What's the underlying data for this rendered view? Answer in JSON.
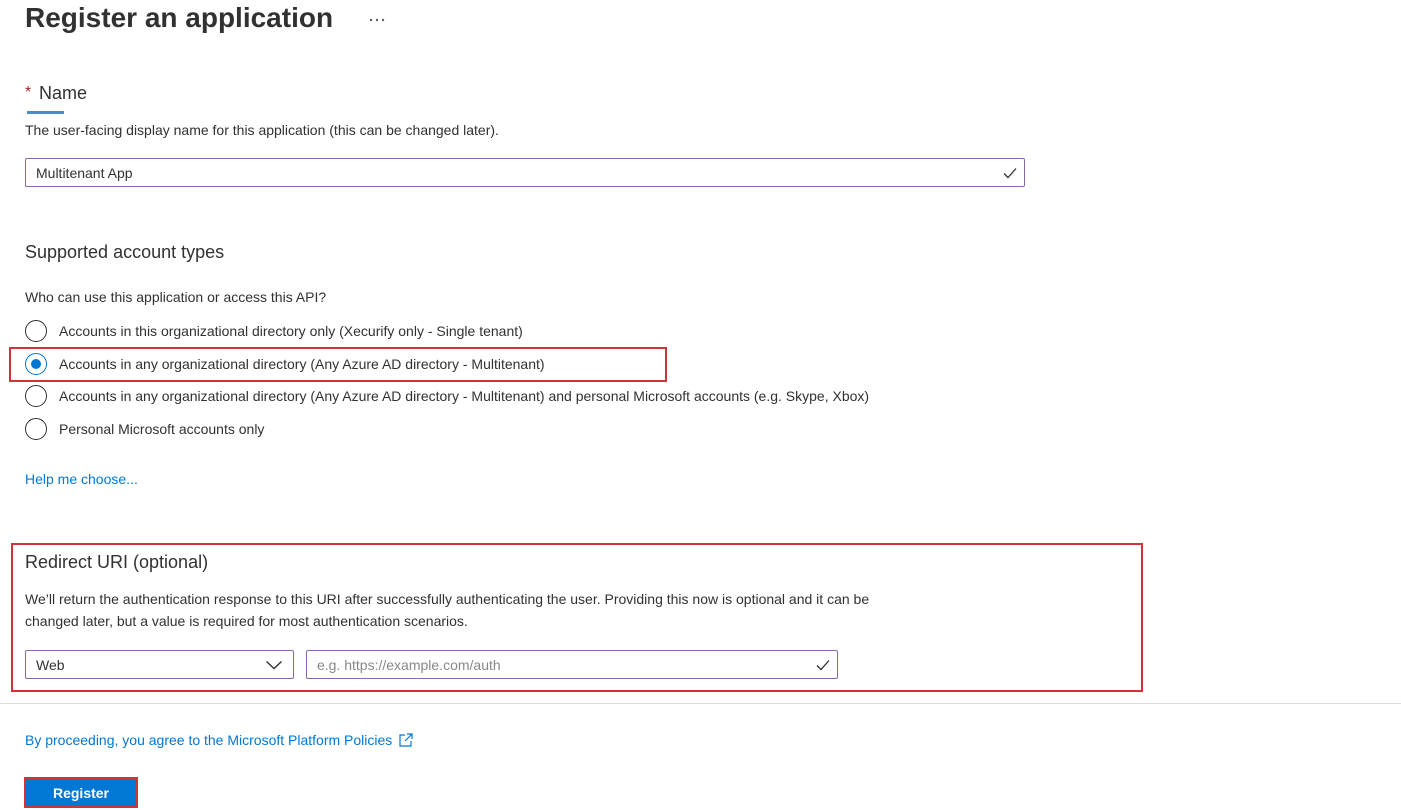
{
  "page": {
    "title": "Register an application"
  },
  "name_section": {
    "required_mark": "*",
    "label": "Name",
    "description": "The user-facing display name for this application (this can be changed later).",
    "value": "Multitenant App"
  },
  "account_types": {
    "title": "Supported account types",
    "question": "Who can use this application or access this API?",
    "options": [
      {
        "label": "Accounts in this organizational directory only (Xecurify only - Single tenant)",
        "selected": false
      },
      {
        "label": "Accounts in any organizational directory (Any Azure AD directory - Multitenant)",
        "selected": true
      },
      {
        "label": "Accounts in any organizational directory (Any Azure AD directory - Multitenant) and personal Microsoft accounts (e.g. Skype, Xbox)",
        "selected": false
      },
      {
        "label": "Personal Microsoft accounts only",
        "selected": false
      }
    ],
    "help_link": "Help me choose..."
  },
  "redirect": {
    "title": "Redirect URI (optional)",
    "description_line1": "We’ll return the authentication response to this URI after successfully authenticating the user. Providing this now is optional and it can be",
    "description_line2": "changed later, but a value is required for most authentication scenarios.",
    "platform_value": "Web",
    "uri_placeholder": "e.g. https://example.com/auth",
    "uri_value": ""
  },
  "footer": {
    "policy_text": "By proceeding, you agree to the Microsoft Platform Policies",
    "register_label": "Register"
  },
  "colors": {
    "accent": "#0078d4",
    "highlight": "#d13438",
    "field_border": "#8a67ab"
  },
  "icons": {
    "more": "more-horizontal-icon",
    "check": "checkmark-icon",
    "chevron": "chevron-down-icon",
    "external": "external-link-icon"
  }
}
